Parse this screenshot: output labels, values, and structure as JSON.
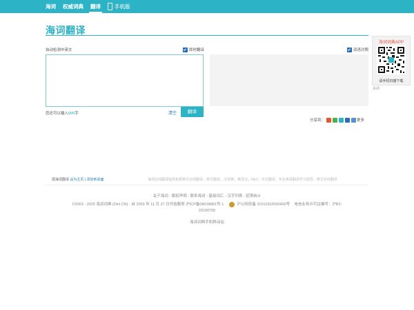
{
  "nav": {
    "items": [
      {
        "label": "海词"
      },
      {
        "label": "权威词典"
      },
      {
        "label": "翻译"
      }
    ],
    "mobile_label": "手机版"
  },
  "logo": "海词翻译",
  "input": {
    "auto_detect_label": "自动检测中英文",
    "instant_label": "即时翻译",
    "value": "",
    "remain_prefix": "您还可以输入",
    "remain_count": "800",
    "remain_suffix": "字",
    "clear_label": "清空",
    "translate_label": "翻译"
  },
  "output": {
    "bilingual_label": "双语对照"
  },
  "share": {
    "label": "分享到：",
    "more_label": "更多",
    "colors": [
      "#e4572e",
      "#4caf50",
      "#2db3c6",
      "#2a6fb5",
      "#e74c3c"
    ]
  },
  "app": {
    "title": "海词词典APP",
    "caption": "请手机扫描下载",
    "close_label": "关闭"
  },
  "footer": {
    "set_translate": "把海词翻译",
    "set_home": "设为主页",
    "add_desktop": "添加到桌面",
    "tagline": "海词在线翻译提供免费英文在线翻译，英文翻译，汉译英，英译汉，Mp3，中文翻译，专业英语翻译学习指导，英文在线翻译",
    "links": "关于海词 - 版权声明 - 联系海词 - 星级词汇 - 汉字列表 - 招贤纳士",
    "copyright": "©2003 - 2025 海词词典 (Dict.CN) - 自 2003 年 11 月 27 日开始服务   沪ICP备08018881号-1",
    "police": "沪公网安备 31011502000490号",
    "license": "电信业务许可证编号：沪B2-",
    "license_cont": "20190700",
    "mobile_site": "海词词典手机移动站"
  }
}
